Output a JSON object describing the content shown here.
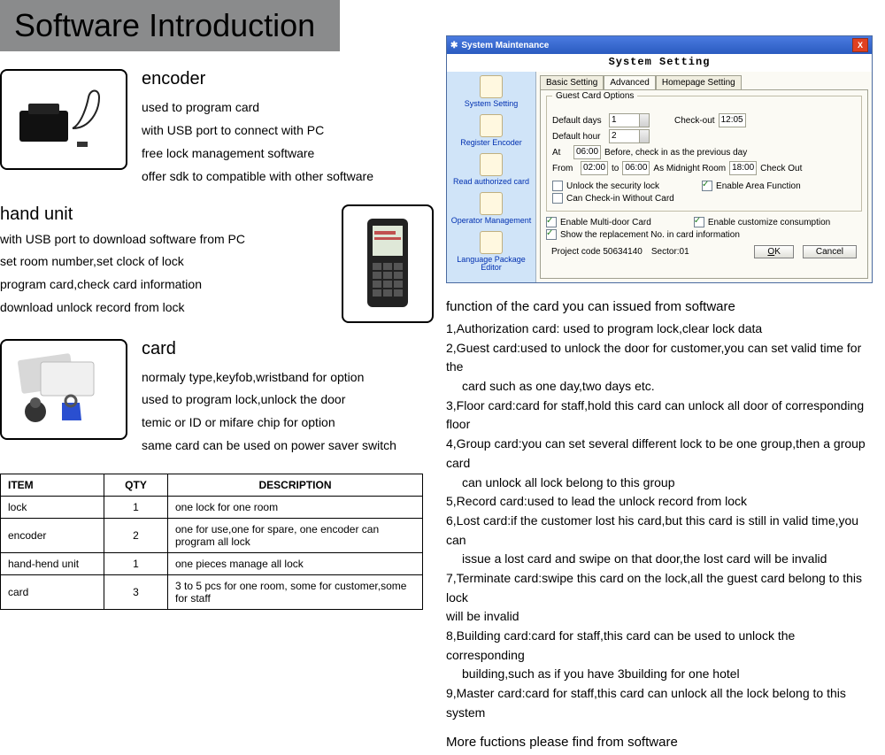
{
  "title": "Software Introduction",
  "encoder": {
    "heading": "encoder",
    "l1": "used to program card",
    "l2": "with USB port to connect with PC",
    "l3": "free lock management software",
    "l4": "offer sdk to compatible with other software"
  },
  "hand_unit": {
    "heading": "hand unit",
    "l1": "with USB port to download software from PC",
    "l2": "set room number,set clock of lock",
    "l3": "program card,check card information",
    "l4": "download unlock record from lock"
  },
  "card": {
    "heading": "card",
    "l1": "normaly type,keyfob,wristband for option",
    "l2": "used to program lock,unlock the door",
    "l3": "temic or ID or mifare chip for option",
    "l4": "same card can be used on power saver switch"
  },
  "table": {
    "headers": {
      "item": "ITEM",
      "qty": "QTY",
      "desc": "DESCRIPTION"
    },
    "rows": [
      {
        "item": "lock",
        "qty": "1",
        "desc": "one lock for one room"
      },
      {
        "item": "encoder",
        "qty": "2",
        "desc": "one for use,one for spare, one encoder can program all lock"
      },
      {
        "item": "hand-hend unit",
        "qty": "1",
        "desc": "one pieces manage all lock"
      },
      {
        "item": "card",
        "qty": "3",
        "desc": "3 to 5 pcs for one room, some for customer,some for staff"
      }
    ]
  },
  "dlg": {
    "title": "System Maintenance",
    "heading": "System Setting",
    "sidebar": [
      "System Setting",
      "Register Encoder",
      "Read authorized card",
      "Operator Management",
      "Language Package Editor"
    ],
    "tabs": [
      "Basic Setting",
      "Advanced",
      "Homepage Setting"
    ],
    "fieldset_title": "Guest Card Options",
    "default_days_lbl": "Default days",
    "default_days_val": "1",
    "checkout_lbl": "Check-out",
    "checkout_val": "12:05",
    "default_hour_lbl": "Default hour",
    "default_hour_val": "2",
    "at_lbl": "At",
    "at_val": "06:00",
    "before_txt": "Before, check in as the previous day",
    "from_lbl": "From",
    "from_val": "02:00",
    "to_lbl": "to",
    "to_val": "06:00",
    "midnight_lbl": "As Midnight Room",
    "midnight_val": "18:00",
    "checkout2_lbl": "Check Out",
    "cb_unlock": "Unlock the security lock",
    "cb_area": "Enable Area Function",
    "cb_noc": "Can Check-in Without Card",
    "cb_multi": "Enable Multi-door Card",
    "cb_cons": "Enable customize consumption",
    "cb_repl": "Show the replacement No. in card information",
    "proj_lbl": "Project code",
    "proj_val": "50634140",
    "sector_lbl": "Sector:01",
    "ok": "OK",
    "cancel": "Cancel"
  },
  "right": {
    "heading1": "function of the card you can issued from software",
    "l1": "1,Authorization card: used to program lock,clear lock data",
    "l2a": "2,Guest card:used to unlock the door for customer,you can set valid time for the",
    "l2b": "card such as one day,two days etc.",
    "l3": "3,Floor card:card for staff,hold this card can unlock all door of corresponding floor",
    "l4a": "4,Group card:you can set several different lock to be one group,then a group card",
    "l4b": "can unlock all lock belong to this group",
    "l5": "5,Record card:used to lead the unlock record from lock",
    "l6a": "6,Lost card:if the customer lost his card,but this card is still in valid time,you can",
    "l6b": "issue a lost card and swipe on that door,the lost card will be invalid",
    "l7a": "7,Terminate card:swipe this card on the lock,all the guest card belong to this lock",
    "l7b": "will be invalid",
    "l8a": "8,Building card:card for staff,this card can be used to unlock the corresponding",
    "l8b": "building,such as if you have 3building for one hotel",
    "l9": "9,Master card:card for staff,this card can unlock all the lock belong to this system",
    "heading2": "More fuctions please find from software"
  }
}
